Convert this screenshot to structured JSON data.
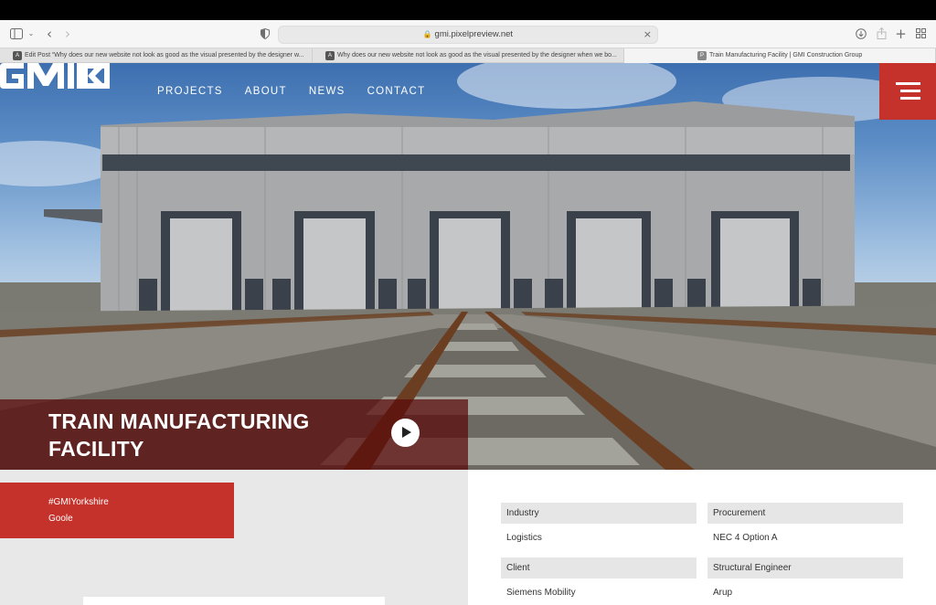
{
  "browser": {
    "url": "gmi.pixelpreview.net",
    "tabs": [
      {
        "label": "Edit Post “Why does our new website not look as good as the visual presented by the designer w..."
      },
      {
        "label": "Why does our new website not look as good as the visual presented by the designer when we bo..."
      },
      {
        "label": "Train Manufacturing Facility | GMI Construction Group"
      }
    ],
    "icons": [
      "sidebar-icon",
      "chevron-down-icon",
      "back-icon",
      "forward-icon",
      "shield-icon",
      "lock-icon",
      "close-icon",
      "download-icon",
      "share-icon",
      "plus-icon",
      "tabs-grid-icon"
    ]
  },
  "site": {
    "logo_text": "GMI",
    "nav": [
      "PROJECTS",
      "ABOUT",
      "NEWS",
      "CONTACT"
    ],
    "accent_color": "#c4322b",
    "hero_title_line1": "TRAIN MANUFACTURING",
    "hero_title_line2": "FACILITY",
    "tags": {
      "hashtag": "#GMIYorkshire",
      "location": "Goole"
    },
    "info": [
      {
        "label": "Industry",
        "value": "Logistics"
      },
      {
        "label": "Procurement",
        "value": "NEC 4 Option A"
      },
      {
        "label": "Client",
        "value": "Siemens Mobility"
      },
      {
        "label": "Structural Engineer",
        "value": "Arup"
      }
    ]
  }
}
